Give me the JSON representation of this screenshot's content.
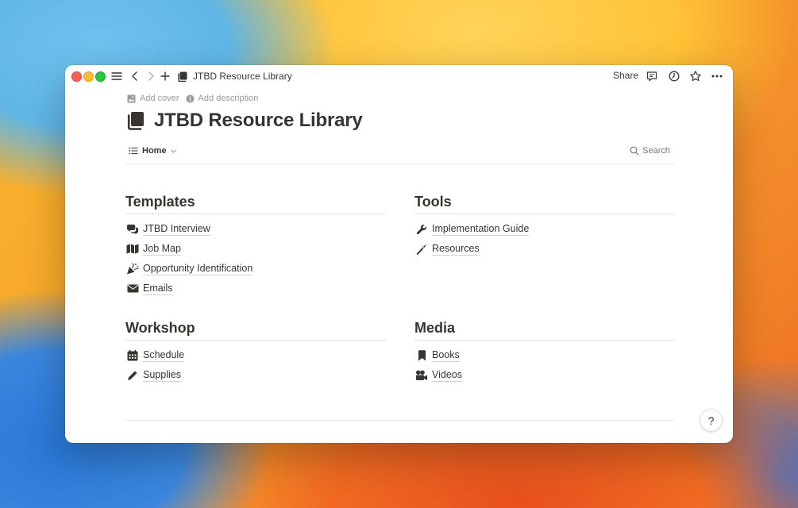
{
  "window": {
    "breadcrumb_title": "JTBD Resource Library",
    "share_label": "Share"
  },
  "page": {
    "add_cover_label": "Add cover",
    "add_description_label": "Add description",
    "title": "JTBD Resource Library",
    "view_tab_label": "Home",
    "search_label": "Search"
  },
  "sections": {
    "templates": {
      "heading": "Templates",
      "items": [
        {
          "label": "JTBD Interview",
          "icon": "comments-icon"
        },
        {
          "label": "Job Map",
          "icon": "map-icon"
        },
        {
          "label": "Opportunity Identification",
          "icon": "party-popper-icon"
        },
        {
          "label": "Emails",
          "icon": "envelope-icon"
        }
      ]
    },
    "tools": {
      "heading": "Tools",
      "items": [
        {
          "label": "Implementation Guide",
          "icon": "wrench-icon"
        },
        {
          "label": "Resources",
          "icon": "screwdriver-icon"
        }
      ]
    },
    "workshop": {
      "heading": "Workshop",
      "items": [
        {
          "label": "Schedule",
          "icon": "calendar-icon"
        },
        {
          "label": "Supplies",
          "icon": "pencil-icon"
        }
      ]
    },
    "media": {
      "heading": "Media",
      "items": [
        {
          "label": "Books",
          "icon": "bookmark-icon"
        },
        {
          "label": "Videos",
          "icon": "video-camera-icon"
        }
      ]
    }
  },
  "help_label": "?",
  "colors": {
    "text": "#37352f",
    "muted": "#9b9a97",
    "close": "#fe5f57",
    "minimize": "#febc2e",
    "maximize": "#28c840"
  }
}
